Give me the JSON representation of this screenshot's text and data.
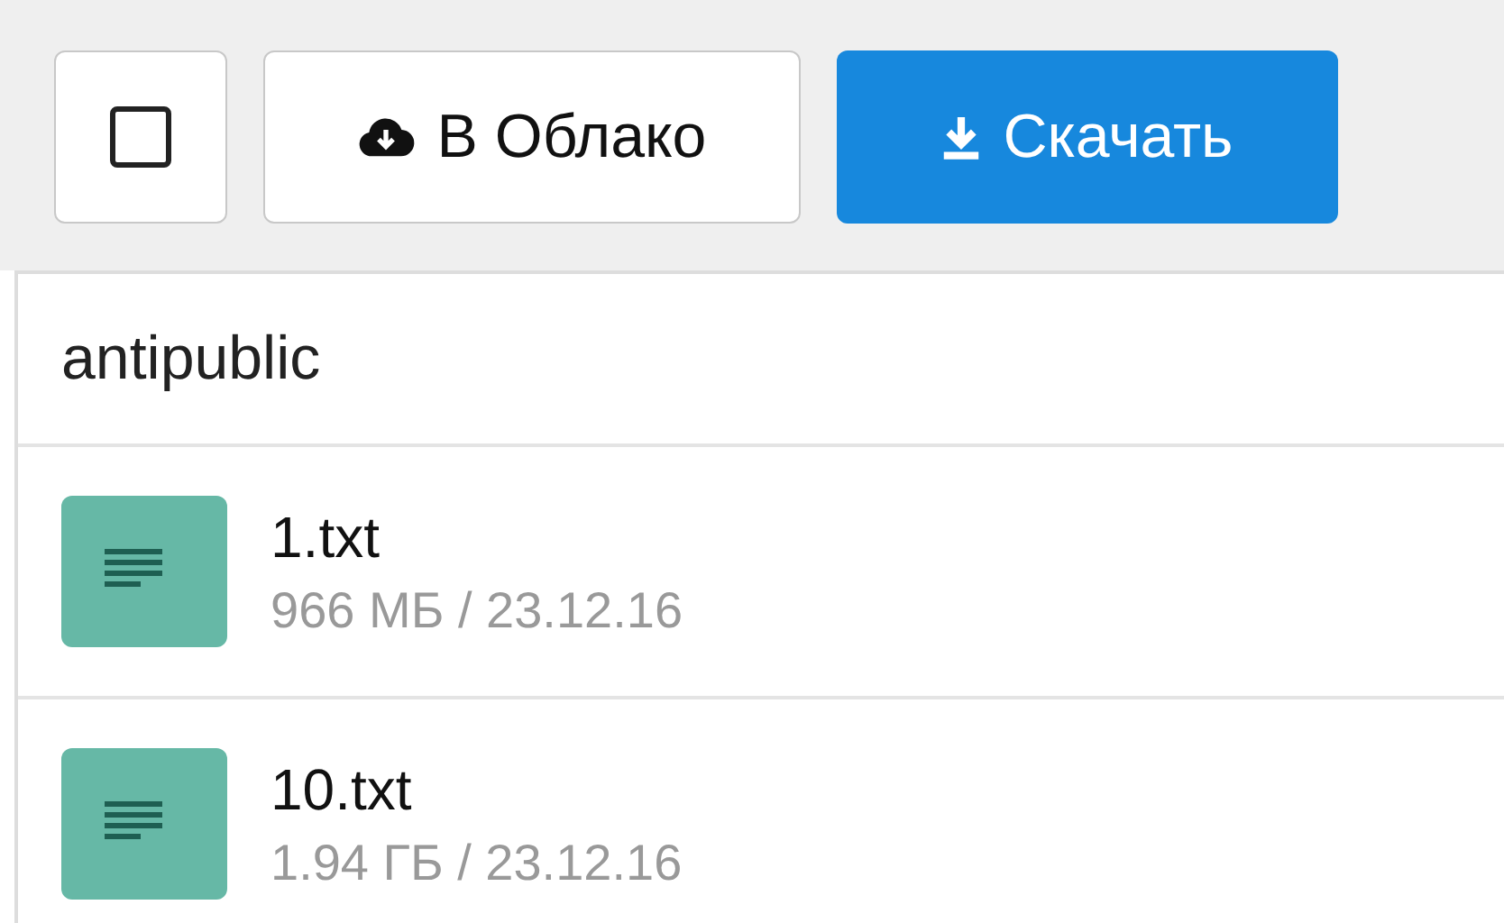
{
  "toolbar": {
    "select_all": {
      "checked": false
    },
    "buttons": [
      {
        "kind": "cloud",
        "label": "В Облако"
      },
      {
        "kind": "download",
        "label": "Скачать"
      }
    ]
  },
  "folder": {
    "title": "antipublic"
  },
  "files": [
    {
      "name": "1.txt",
      "meta": "966 МБ / 23.12.16"
    },
    {
      "name": "10.txt",
      "meta": "1.94 ГБ / 23.12.16"
    }
  ]
}
